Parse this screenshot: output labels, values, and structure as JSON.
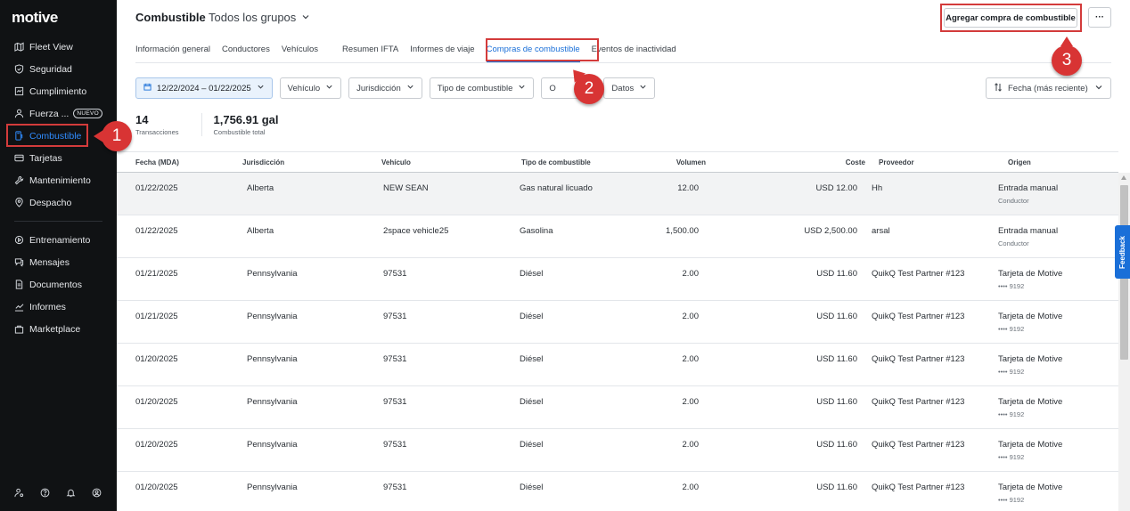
{
  "sidebar": {
    "logo": "motive",
    "items": [
      {
        "label": "Fleet View",
        "icon": "map-icon"
      },
      {
        "label": "Seguridad",
        "icon": "shield-icon"
      },
      {
        "label": "Cumplimiento",
        "icon": "clipboard-icon"
      },
      {
        "label": "Fuerza ...",
        "icon": "person-icon",
        "badge": "NUEVO"
      },
      {
        "label": "Combustible",
        "icon": "fuel-icon",
        "active": true
      },
      {
        "label": "Tarjetas",
        "icon": "card-icon"
      },
      {
        "label": "Mantenimiento",
        "icon": "wrench-icon"
      },
      {
        "label": "Despacho",
        "icon": "location-icon"
      },
      {
        "label": "Entrenamiento",
        "icon": "training-icon"
      },
      {
        "label": "Mensajes",
        "icon": "message-icon"
      },
      {
        "label": "Documentos",
        "icon": "document-icon"
      },
      {
        "label": "Informes",
        "icon": "chart-icon"
      },
      {
        "label": "Marketplace",
        "icon": "bag-icon"
      }
    ],
    "bottom_icons": [
      "user-settings-icon",
      "help-icon",
      "bell-icon",
      "account-icon"
    ]
  },
  "header": {
    "title": "Combustible",
    "group": "Todos los grupos",
    "add_button": "Agregar compra de combustible",
    "more_button": "···"
  },
  "tabs": [
    {
      "label": "Información general"
    },
    {
      "label": "Conductores"
    },
    {
      "label": "Vehículos"
    },
    {
      "label": "Resumen IFTA"
    },
    {
      "label": "Informes de viaje"
    },
    {
      "label": "Compras de combustible",
      "active": true
    },
    {
      "label": "Eventos de inactividad"
    }
  ],
  "filters": {
    "date": "12/22/2024 – 01/22/2025",
    "vehicle": "Vehículo",
    "jurisdiction": "Jurisdicción",
    "fuel_type": "Tipo de combustible",
    "origin": "O",
    "data": "Datos",
    "sort": "Fecha (más reciente)"
  },
  "stats": {
    "transactions_value": "14",
    "transactions_label": "Transacciones",
    "fuel_value": "1,756.91 gal",
    "fuel_label": "Combustible total"
  },
  "table": {
    "headers": [
      "Fecha (MDA)",
      "Jurisdicción",
      "Vehículo",
      "Tipo de combustible",
      "Volumen",
      "Coste",
      "Proveedor",
      "Origen"
    ],
    "rows": [
      {
        "date": "01/22/2025",
        "jurisdiction": "Alberta",
        "vehicle": "NEW SEAN",
        "fuel": "Gas natural licuado",
        "volume": "12.00",
        "cost": "USD 12.00",
        "vendor": "Hh",
        "origin": "Entrada manual",
        "origin_sub": "Conductor"
      },
      {
        "date": "01/22/2025",
        "jurisdiction": "Alberta",
        "vehicle": "2space vehicle25",
        "fuel": "Gasolina",
        "volume": "1,500.00",
        "cost": "USD 2,500.00",
        "vendor": "arsal",
        "origin": "Entrada manual",
        "origin_sub": "Conductor"
      },
      {
        "date": "01/21/2025",
        "jurisdiction": "Pennsylvania",
        "vehicle": "97531",
        "fuel": "Diésel",
        "volume": "2.00",
        "cost": "USD 11.60",
        "vendor": "QuikQ Test Partner #123",
        "origin": "Tarjeta de Motive",
        "origin_sub": "•••• 9192"
      },
      {
        "date": "01/21/2025",
        "jurisdiction": "Pennsylvania",
        "vehicle": "97531",
        "fuel": "Diésel",
        "volume": "2.00",
        "cost": "USD 11.60",
        "vendor": "QuikQ Test Partner #123",
        "origin": "Tarjeta de Motive",
        "origin_sub": "•••• 9192"
      },
      {
        "date": "01/20/2025",
        "jurisdiction": "Pennsylvania",
        "vehicle": "97531",
        "fuel": "Diésel",
        "volume": "2.00",
        "cost": "USD 11.60",
        "vendor": "QuikQ Test Partner #123",
        "origin": "Tarjeta de Motive",
        "origin_sub": "•••• 9192"
      },
      {
        "date": "01/20/2025",
        "jurisdiction": "Pennsylvania",
        "vehicle": "97531",
        "fuel": "Diésel",
        "volume": "2.00",
        "cost": "USD 11.60",
        "vendor": "QuikQ Test Partner #123",
        "origin": "Tarjeta de Motive",
        "origin_sub": "•••• 9192"
      },
      {
        "date": "01/20/2025",
        "jurisdiction": "Pennsylvania",
        "vehicle": "97531",
        "fuel": "Diésel",
        "volume": "2.00",
        "cost": "USD 11.60",
        "vendor": "QuikQ Test Partner #123",
        "origin": "Tarjeta de Motive",
        "origin_sub": "•••• 9192"
      },
      {
        "date": "01/20/2025",
        "jurisdiction": "Pennsylvania",
        "vehicle": "97531",
        "fuel": "Diésel",
        "volume": "2.00",
        "cost": "USD 11.60",
        "vendor": "QuikQ Test Partner #123",
        "origin": "Tarjeta de Motive",
        "origin_sub": "•••• 9192"
      }
    ]
  },
  "feedback": "Feedback",
  "callouts": {
    "one": "1",
    "two": "2",
    "three": "3"
  },
  "colors": {
    "accent": "#1a6fd8",
    "callout": "#d83434",
    "sidebar": "#101214"
  }
}
